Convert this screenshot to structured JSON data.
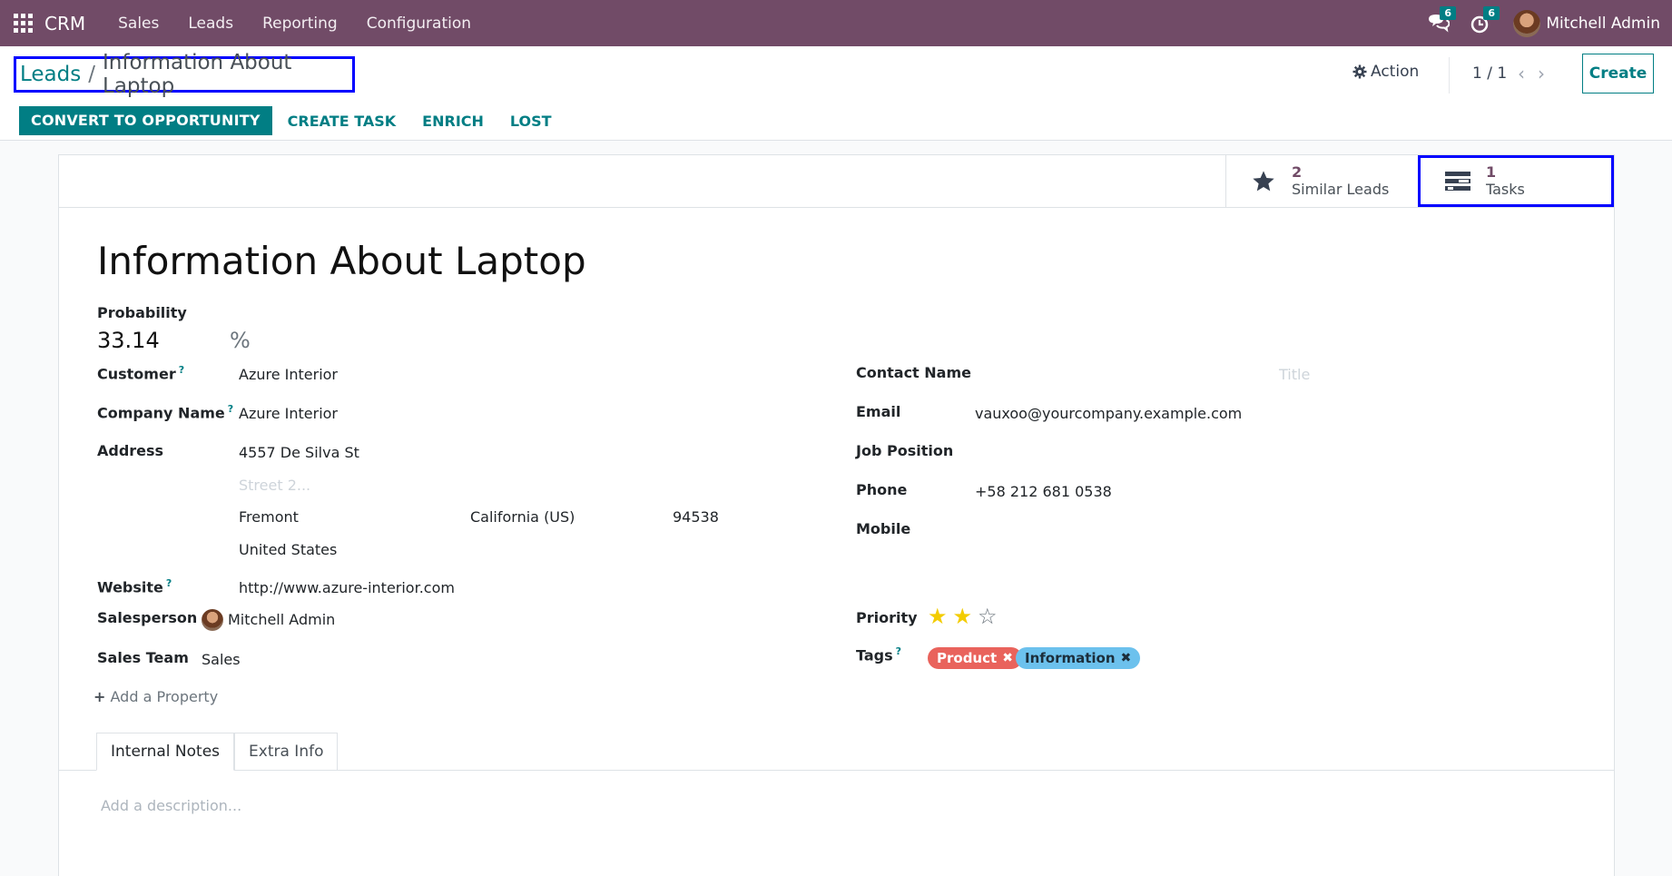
{
  "navbar": {
    "app_name": "CRM",
    "menu": [
      "Sales",
      "Leads",
      "Reporting",
      "Configuration"
    ],
    "messages_count": "6",
    "activities_count": "6",
    "user_name": "Mitchell Admin",
    "bg_color": "#714b67"
  },
  "breadcrumb": {
    "parent": "Leads",
    "separator": "/",
    "current": "Information About Laptop"
  },
  "control": {
    "action_label": "Action",
    "pager": "1 / 1",
    "create_label": "Create"
  },
  "statusbar": {
    "convert_label": "CONVERT TO OPPORTUNITY",
    "create_task_label": "CREATE TASK",
    "enrich_label": "ENRICH",
    "lost_label": "LOST"
  },
  "smart_buttons": {
    "similar": {
      "value": "2",
      "label": "Similar Leads",
      "icon": "star-icon"
    },
    "tasks": {
      "value": "1",
      "label": "Tasks",
      "icon": "tasks-icon"
    }
  },
  "lead": {
    "title": "Information About Laptop",
    "probability_label": "Probability",
    "probability": "33.14",
    "probability_unit": "%",
    "customer_label": "Customer",
    "customer": "Azure Interior",
    "company_label": "Company Name",
    "company": "Azure Interior",
    "address_label": "Address",
    "street": "4557 De Silva St",
    "street2_placeholder": "Street 2...",
    "city": "Fremont",
    "state": "California (US)",
    "zip": "94538",
    "country": "United States",
    "website_label": "Website",
    "website": "http://www.azure-interior.com",
    "salesperson_label": "Salesperson",
    "salesperson": "Mitchell Admin",
    "team_label": "Sales Team",
    "team": "Sales",
    "contact_label": "Contact Name",
    "title_placeholder": "Title",
    "email_label": "Email",
    "email": "vauxoo@yourcompany.example.com",
    "job_label": "Job Position",
    "phone_label": "Phone",
    "phone": "+58 212 681 0538",
    "mobile_label": "Mobile",
    "priority_label": "Priority",
    "priority": 2,
    "priority_max": 3,
    "tags_label": "Tags",
    "tags": [
      {
        "name": "Product",
        "color": "#e9635c"
      },
      {
        "name": "Information",
        "color": "#6cc1ed"
      }
    ],
    "help_mark": "?",
    "add_property_label": "Add a Property"
  },
  "tabs": {
    "notes": "Internal Notes",
    "extra": "Extra Info",
    "description_placeholder": "Add a description..."
  }
}
